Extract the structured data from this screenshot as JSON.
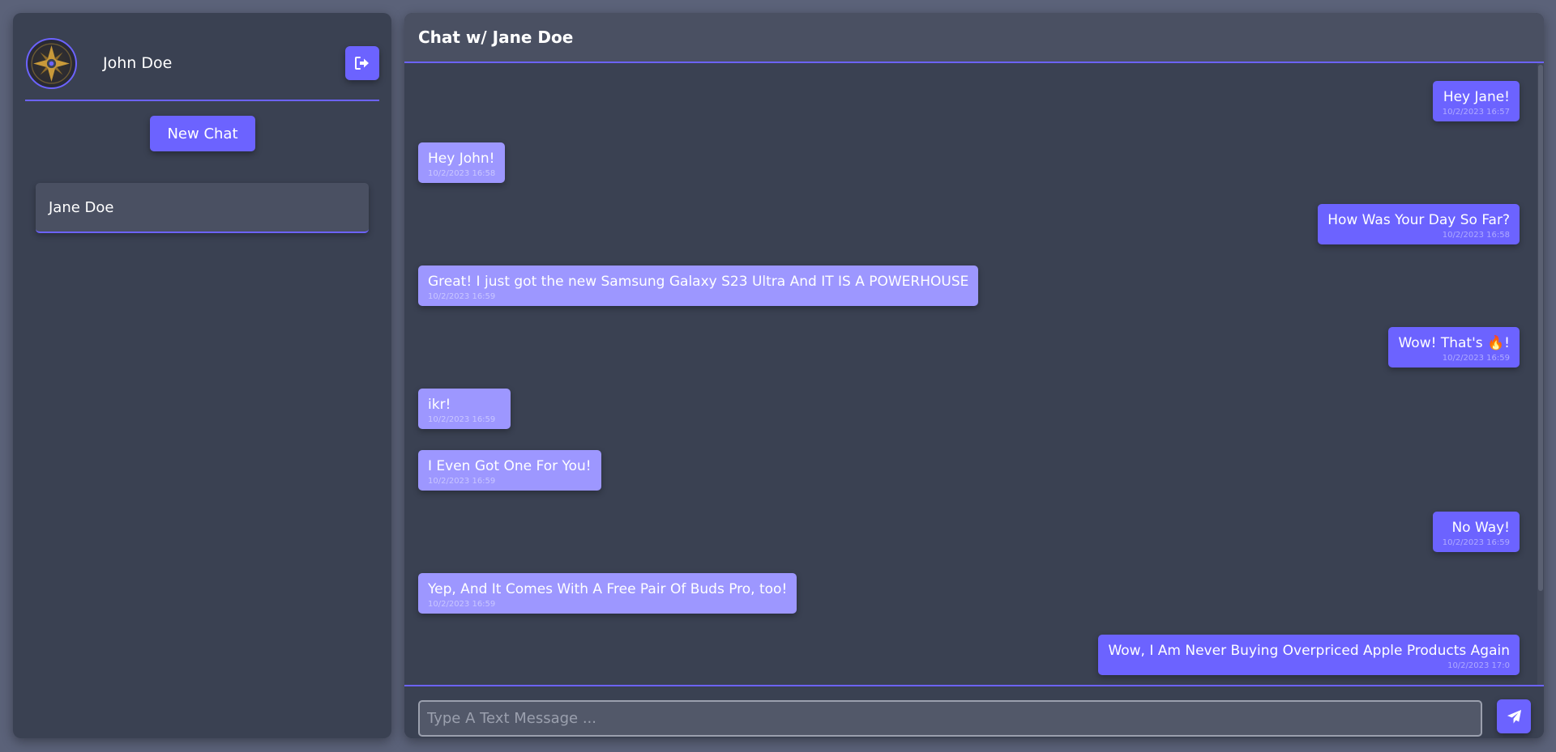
{
  "colors": {
    "accent": "#6c63ff",
    "received_bubble": "#9d97ff",
    "panel": "#3a4152",
    "panel_header": "#4a5062",
    "background": "#5b6279"
  },
  "sidebar": {
    "profile": {
      "name": "John Doe",
      "avatar_icon": "ornate-compass-avatar",
      "logout_icon": "sign-out-icon"
    },
    "new_chat_label": "New Chat",
    "chats": [
      {
        "name": "Jane Doe"
      }
    ]
  },
  "chat": {
    "title": "Chat w/ Jane Doe",
    "messages": [
      {
        "direction": "sent",
        "text": "Hey Jane!",
        "time": "10/2/2023 16:57"
      },
      {
        "direction": "received",
        "text": "Hey John!",
        "time": "10/2/2023 16:58"
      },
      {
        "direction": "sent",
        "text": "How Was Your Day So Far?",
        "time": "10/2/2023 16:58"
      },
      {
        "direction": "received",
        "text": "Great! I just got the new Samsung Galaxy S23 Ultra And IT IS A POWERHOUSE",
        "time": "10/2/2023 16:59"
      },
      {
        "direction": "sent",
        "text_before": "Wow! That's ",
        "emoji": "🔥",
        "text_after": "!",
        "time": "10/2/2023 16:59"
      },
      {
        "direction": "received",
        "text": "ikr!",
        "time": "10/2/2023 16:59"
      },
      {
        "direction": "received",
        "text": "I Even Got One For You!",
        "time": "10/2/2023 16:59"
      },
      {
        "direction": "sent",
        "text": "No Way!",
        "time": "10/2/2023 16:59"
      },
      {
        "direction": "received",
        "text": "Yep, And It Comes With A Free Pair Of Buds Pro, too!",
        "time": "10/2/2023 16:59"
      },
      {
        "direction": "sent",
        "text": "Wow, I Am Never Buying Overpriced Apple Products Again",
        "time": "10/2/2023 17:0"
      }
    ],
    "composer": {
      "placeholder": "Type A Text Message ...",
      "value": "",
      "send_icon": "paper-plane-icon"
    }
  }
}
